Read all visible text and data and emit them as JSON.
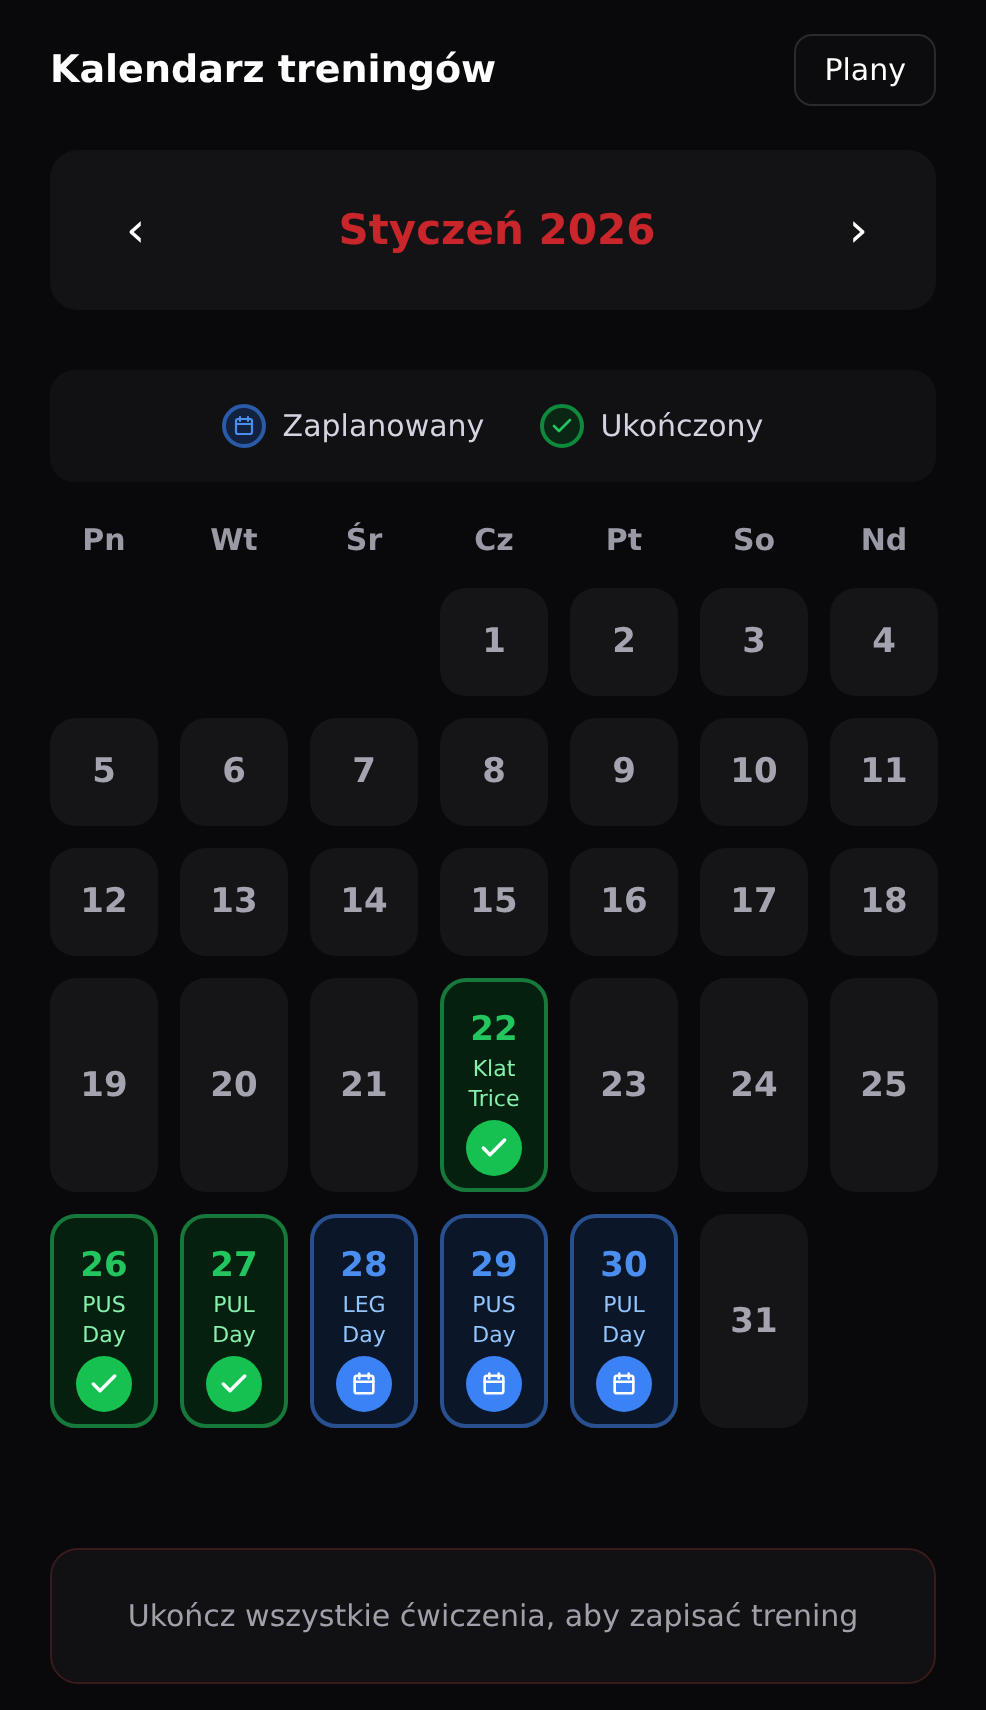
{
  "header": {
    "title": "Kalendarz treningów",
    "plans_button": "Plany"
  },
  "month_nav": {
    "prev": "‹",
    "title": "Styczeń 2026",
    "next": "›"
  },
  "legend": [
    {
      "kind": "planned",
      "label": "Zaplanowany"
    },
    {
      "kind": "completed",
      "label": "Ukończony"
    }
  ],
  "weekdays": [
    "Pn",
    "Wt",
    "Śr",
    "Cz",
    "Pt",
    "So",
    "Nd"
  ],
  "days": [
    {
      "kind": "empty"
    },
    {
      "kind": "empty"
    },
    {
      "kind": "empty"
    },
    {
      "kind": "none",
      "day": "1"
    },
    {
      "kind": "none",
      "day": "2"
    },
    {
      "kind": "none",
      "day": "3"
    },
    {
      "kind": "none",
      "day": "4"
    },
    {
      "kind": "none",
      "day": "5"
    },
    {
      "kind": "none",
      "day": "6"
    },
    {
      "kind": "none",
      "day": "7"
    },
    {
      "kind": "none",
      "day": "8"
    },
    {
      "kind": "none",
      "day": "9"
    },
    {
      "kind": "none",
      "day": "10"
    },
    {
      "kind": "none",
      "day": "11"
    },
    {
      "kind": "none",
      "day": "12"
    },
    {
      "kind": "none",
      "day": "13"
    },
    {
      "kind": "none",
      "day": "14"
    },
    {
      "kind": "none",
      "day": "15"
    },
    {
      "kind": "none",
      "day": "16"
    },
    {
      "kind": "none",
      "day": "17"
    },
    {
      "kind": "none",
      "day": "18"
    },
    {
      "kind": "none",
      "day": "19"
    },
    {
      "kind": "none",
      "day": "20"
    },
    {
      "kind": "none",
      "day": "21"
    },
    {
      "kind": "completed",
      "day": "22",
      "label": "Klat Trice"
    },
    {
      "kind": "none",
      "day": "23"
    },
    {
      "kind": "none",
      "day": "24"
    },
    {
      "kind": "none",
      "day": "25"
    },
    {
      "kind": "completed",
      "day": "26",
      "label": "PUS Day"
    },
    {
      "kind": "completed",
      "day": "27",
      "label": "PUL Day"
    },
    {
      "kind": "planned",
      "day": "28",
      "label": "LEG Day"
    },
    {
      "kind": "planned",
      "day": "29",
      "label": "PUS Day"
    },
    {
      "kind": "planned",
      "day": "30",
      "label": "PUL Day"
    },
    {
      "kind": "none",
      "day": "31"
    }
  ],
  "footer": {
    "message": "Ukończ wszystkie ćwiczenia, aby zapisać trening"
  }
}
